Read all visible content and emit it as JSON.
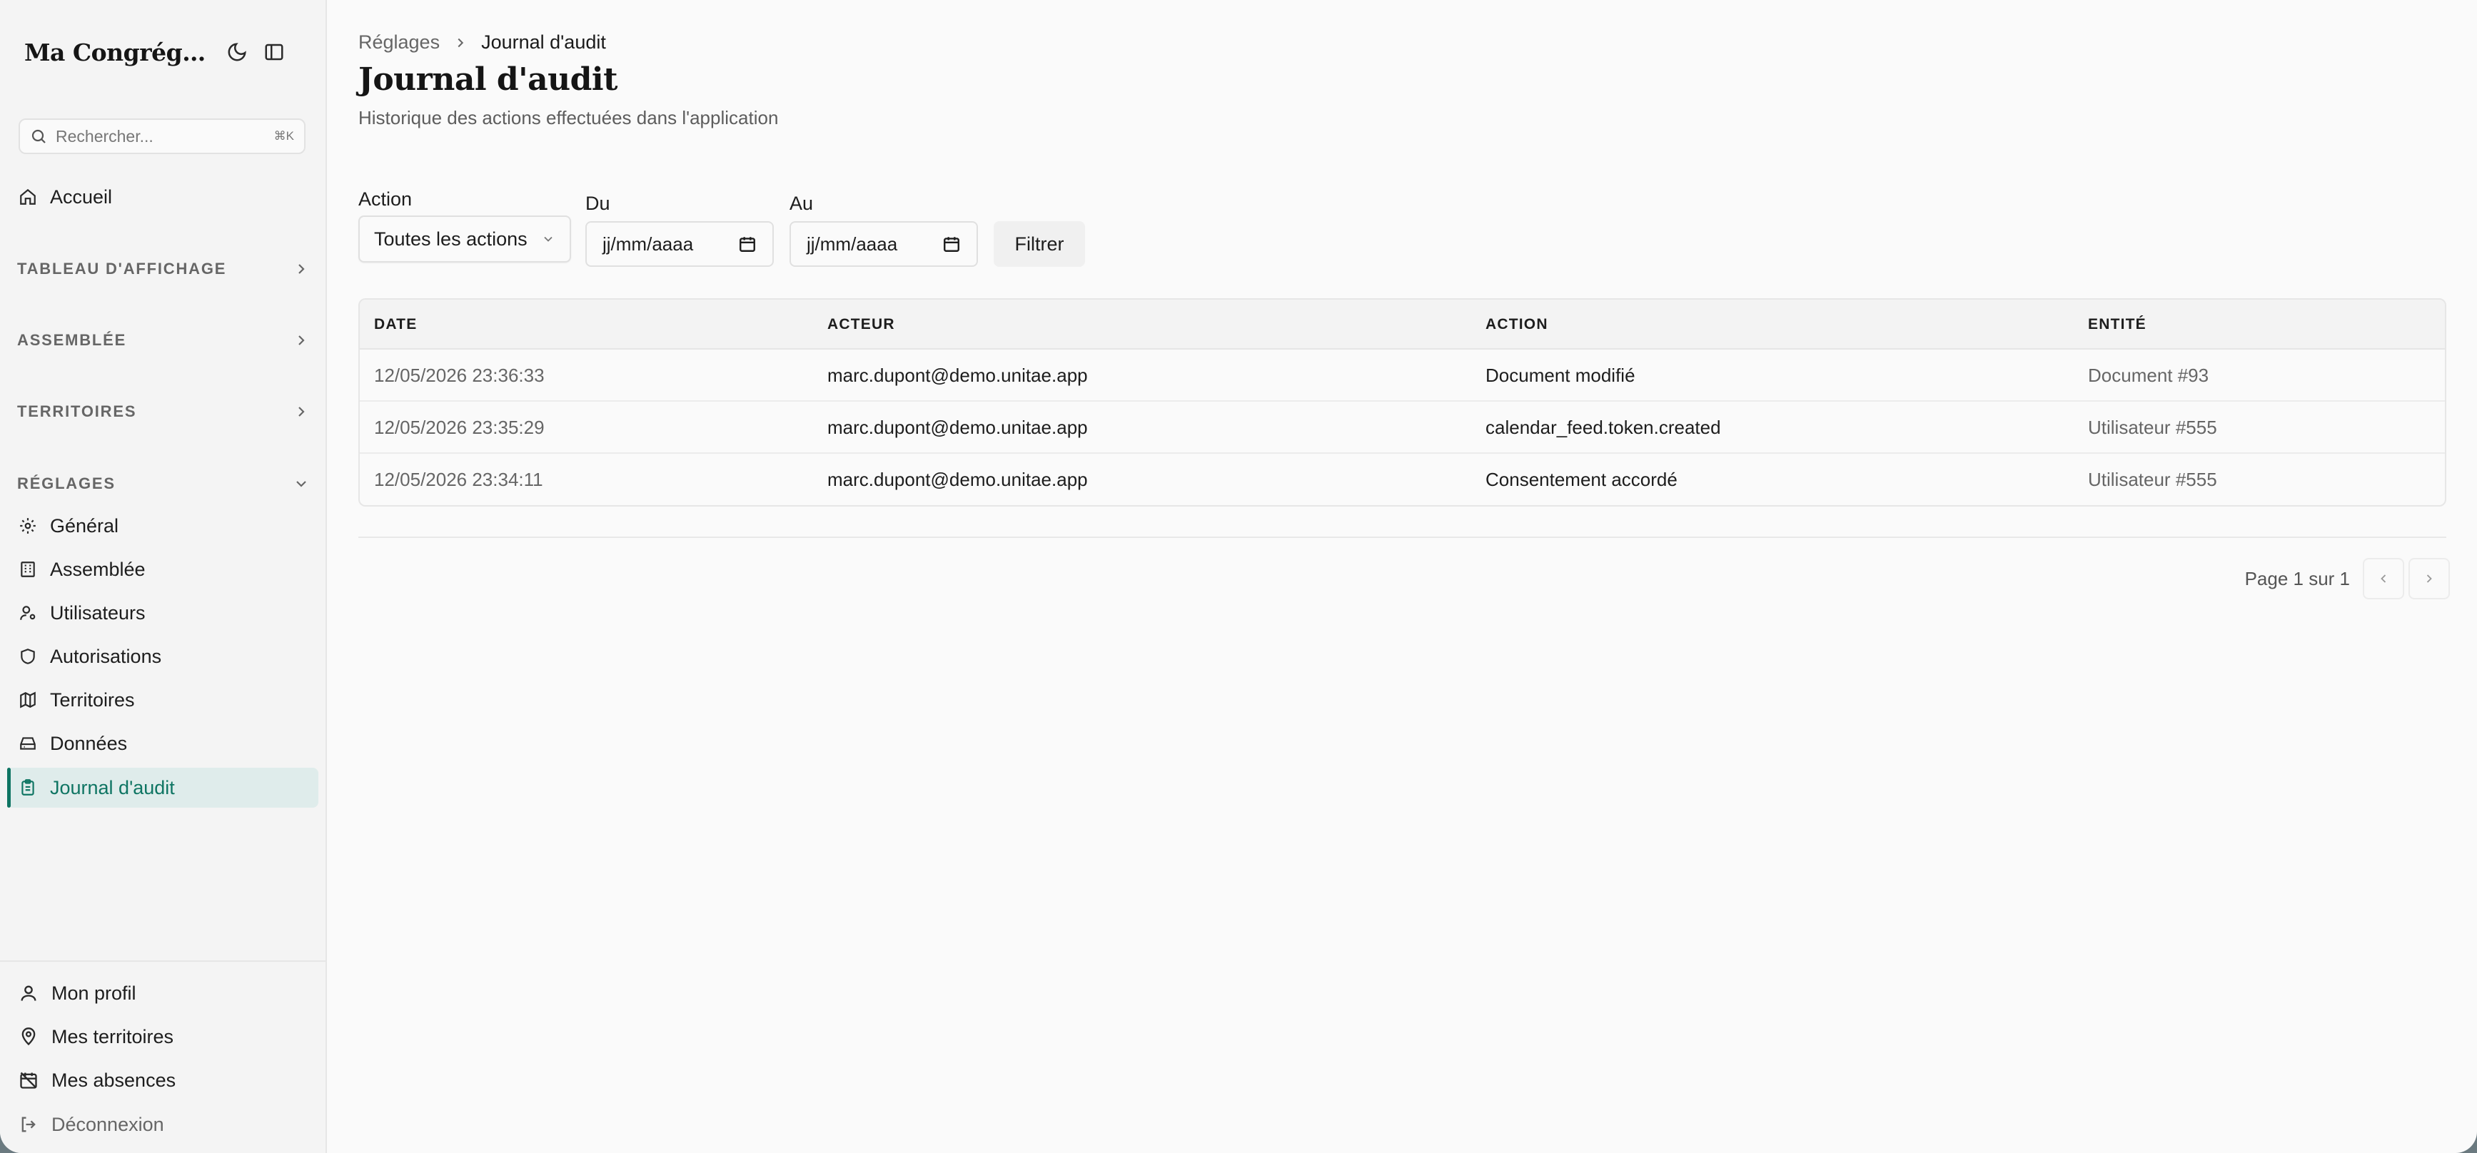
{
  "app": {
    "brand": "Ma Congrégation"
  },
  "search": {
    "placeholder": "Rechercher...",
    "shortcut": "⌘K"
  },
  "sidebar": {
    "home": "Accueil",
    "sections": [
      {
        "label": "TABLEAU D'AFFICHAGE",
        "expanded": false
      },
      {
        "label": "ASSEMBLÉE",
        "expanded": false
      },
      {
        "label": "TERRITOIRES",
        "expanded": false
      },
      {
        "label": "RÉGLAGES",
        "expanded": true
      }
    ],
    "settings_items": [
      {
        "label": "Général",
        "icon": "gear-icon"
      },
      {
        "label": "Assemblée",
        "icon": "building-icon"
      },
      {
        "label": "Utilisateurs",
        "icon": "user-settings-icon"
      },
      {
        "label": "Autorisations",
        "icon": "shield-icon"
      },
      {
        "label": "Territoires",
        "icon": "map-icon"
      },
      {
        "label": "Données",
        "icon": "drive-icon"
      },
      {
        "label": "Journal d'audit",
        "icon": "clipboard-icon",
        "active": true
      }
    ],
    "bottom": [
      {
        "label": "Mon profil",
        "icon": "user-icon"
      },
      {
        "label": "Mes territoires",
        "icon": "map-pin-icon"
      },
      {
        "label": "Mes absences",
        "icon": "calendar-off-icon"
      },
      {
        "label": "Déconnexion",
        "icon": "logout-icon"
      }
    ]
  },
  "breadcrumb": {
    "parent": "Réglages",
    "current": "Journal d'audit"
  },
  "page": {
    "title": "Journal d'audit",
    "subtitle": "Historique des actions effectuées dans l'application"
  },
  "filters": {
    "action_label": "Action",
    "action_value": "Toutes les actions",
    "from_label": "Du",
    "from_placeholder": "jj/mm/aaaa",
    "to_label": "Au",
    "to_placeholder": "jj/mm/aaaa",
    "submit": "Filtrer"
  },
  "table": {
    "columns": [
      "DATE",
      "ACTEUR",
      "ACTION",
      "ENTITÉ"
    ],
    "rows": [
      [
        "12/05/2026 23:36:33",
        "marc.dupont@demo.unitae.app",
        "Document modifié",
        "Document #93"
      ],
      [
        "12/05/2026 23:35:29",
        "marc.dupont@demo.unitae.app",
        "calendar_feed.token.created",
        "Utilisateur #555"
      ],
      [
        "12/05/2026 23:34:11",
        "marc.dupont@demo.unitae.app",
        "Consentement accordé",
        "Utilisateur #555"
      ]
    ]
  },
  "pagination": {
    "text": "Page 1 sur 1"
  },
  "colors": {
    "accent": "#0f7563",
    "active_bg": "#dfeceb"
  }
}
